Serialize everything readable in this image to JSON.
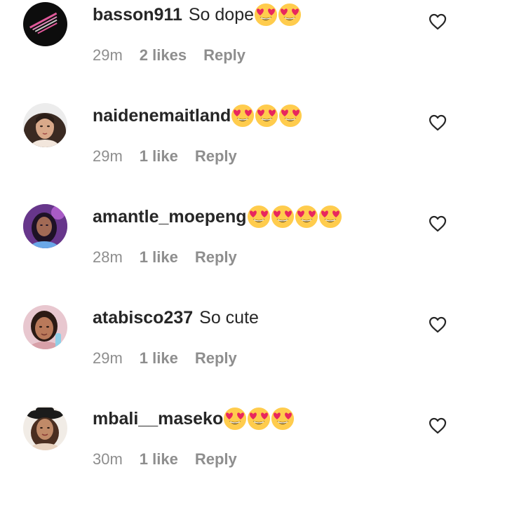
{
  "comments": [
    {
      "username": "basson911",
      "text": "So dope",
      "emoji_count": 2,
      "time": "29m",
      "likes": "2 likes",
      "reply": "Reply",
      "avatar": "dark-logo-avatar"
    },
    {
      "username": "naidenemaitland",
      "text": "",
      "emoji_count": 3,
      "time": "29m",
      "likes": "1 like",
      "reply": "Reply",
      "avatar": "photo-avatar-light"
    },
    {
      "username": "amantle_moepeng",
      "text": "",
      "emoji_count": 4,
      "time": "28m",
      "likes": "1 like",
      "reply": "Reply",
      "avatar": "photo-avatar-purple"
    },
    {
      "username": "atabisco237",
      "text": "So cute",
      "emoji_count": 0,
      "time": "29m",
      "likes": "1 like",
      "reply": "Reply",
      "avatar": "photo-avatar-pink"
    },
    {
      "username": "mbali__maseko",
      "text": "",
      "emoji_count": 3,
      "time": "30m",
      "likes": "1 like",
      "reply": "Reply",
      "avatar": "photo-avatar-hat"
    }
  ],
  "colors": {
    "text": "#262626",
    "secondary": "#8e8e8e",
    "emoji_face": "#ffcc4d",
    "emoji_heart": "#e8265e"
  },
  "icons": {
    "emoji": "smiling-face-with-heart-eyes",
    "like": "heart-outline-icon"
  }
}
